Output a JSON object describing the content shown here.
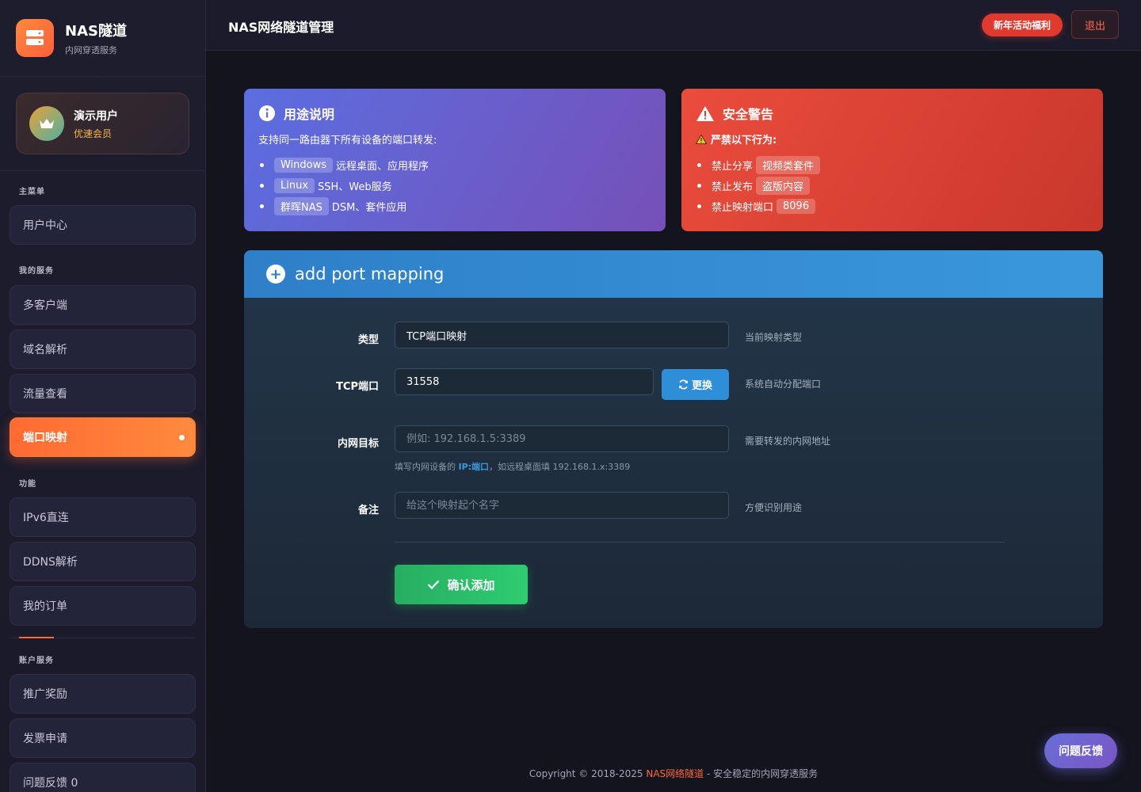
{
  "brand": {
    "title": "NAS隧道",
    "subtitle": "内网穿透服务"
  },
  "user": {
    "name": "演示用户",
    "level": "优速会员"
  },
  "sidebar": {
    "sections": {
      "main": "主菜单",
      "services": "我的服务",
      "functions": "功能",
      "account": "账户服务"
    },
    "items": {
      "user_center": "用户中心",
      "multi_client": "多客户端",
      "domain": "域名解析",
      "traffic": "流量查看",
      "port_mapping": "端口映射",
      "ipv6": "IPv6直连",
      "ddns": "DDNS解析",
      "orders": "我的订单",
      "referral": "推广奖励",
      "invoice": "发票申请",
      "feedback": "问题反馈 0"
    }
  },
  "header": {
    "title": "NAS网络隧道管理",
    "promo_label": "新年活动福利",
    "logout_label": "退出"
  },
  "purpose_card": {
    "title": "用途说明",
    "desc": "支持同一路由器下所有设备的端口转发:",
    "items": [
      {
        "tag": "Windows",
        "text": "远程桌面、应用程序"
      },
      {
        "tag": "Linux",
        "text": "SSH、Web服务"
      },
      {
        "tag": "群晖NAS",
        "text": "DSM、套件应用"
      }
    ]
  },
  "warning_card": {
    "title": "安全警告",
    "desc": "严禁以下行为:",
    "items": [
      {
        "text": "禁止分享",
        "tag": "视频类套件"
      },
      {
        "text": "禁止发布",
        "tag": "盗版内容"
      },
      {
        "text": "禁止映射端口",
        "tag": "8096"
      }
    ]
  },
  "form": {
    "title": "add port mapping",
    "type_label": "类型",
    "type_value": "TCP端口映射",
    "type_hint": "当前映射类型",
    "port_label": "TCP端口",
    "port_value": "31558",
    "refresh_label": "更换",
    "port_hint": "系统自动分配端口",
    "target_label": "内网目标",
    "target_placeholder": "例如: 192.168.1.5:3389",
    "target_hint": "需要转发的内网地址",
    "target_sub_prefix": "填写内网设备的 ",
    "target_sub_bold": "IP:端口",
    "target_sub_suffix": "，如远程桌面填 192.168.1.x:3389",
    "note_label": "备注",
    "note_placeholder": "给这个映射起个名字",
    "note_hint": "方便识别用途",
    "submit_label": "确认添加"
  },
  "footer": {
    "prefix": "Copyright © 2018-2025 ",
    "brand": "NAS网络隧道",
    "suffix": " - 安全稳定的内网穿透服务"
  },
  "feedback_button": "问题反馈",
  "colors": {
    "accent": "#ff6a33",
    "primary": "#2e8fd8",
    "success": "#27ae60",
    "danger": "#e03a2f"
  }
}
